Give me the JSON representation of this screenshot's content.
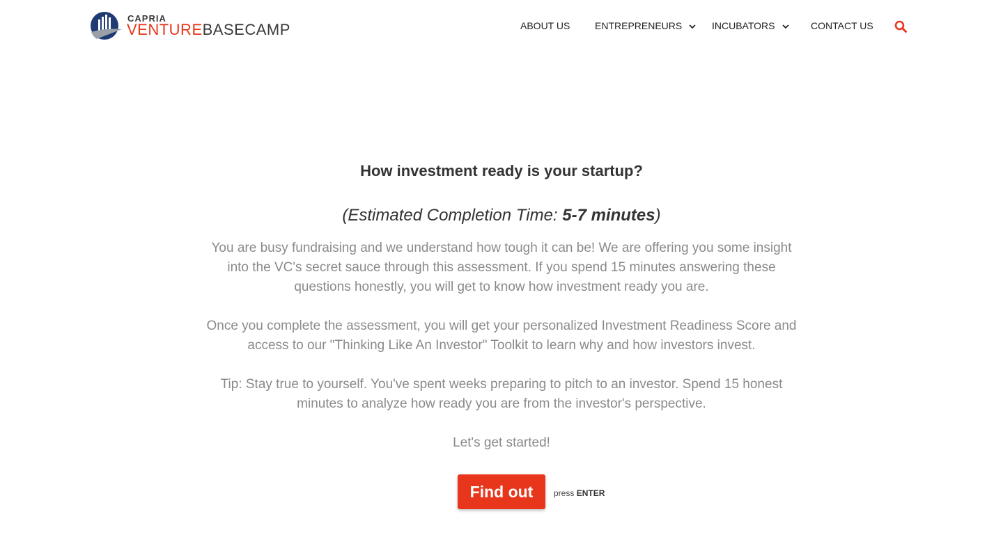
{
  "header": {
    "logo": {
      "small": "CAPRIA",
      "big_first": "VENTURE",
      "big_second": "BASECAMP"
    },
    "nav": {
      "about": "ABOUT US",
      "entrepreneurs": "ENTREPRENEURS",
      "incubators": "INCUBATORS",
      "contact": "CONTACT US"
    },
    "icons": {
      "chevron": "chevron-down-icon",
      "search": "search-icon"
    }
  },
  "main": {
    "title": "How investment ready is your startup?",
    "time_prefix": "(Estimated Completion Time: ",
    "time_value": "5-7 minutes",
    "time_suffix": ")",
    "paragraphs": [
      "You are busy fundraising and we understand how tough it can be! We are offering you some insight into the VC's secret sauce through this assessment. If you spend 15 minutes answering these questions honestly, you will get to know how investment ready you are.",
      "Once you complete the assessment, you will get your personalized Investment Readiness Score and access to our \"Thinking Like An Investor\" Toolkit to learn why and how investors invest.",
      "Tip: Stay true to yourself. You've spent weeks preparing to pitch to an investor. Spend 15 honest minutes to analyze how ready you are from the investor's perspective.",
      "Let's get started!"
    ],
    "cta_label": "Find out",
    "hint_prefix": "press",
    "hint_key": "ENTER"
  },
  "colors": {
    "accent": "#e8361c",
    "text_dark": "#333333",
    "text_muted": "#8a8a8a",
    "logo_blue": "#1f3b73"
  }
}
